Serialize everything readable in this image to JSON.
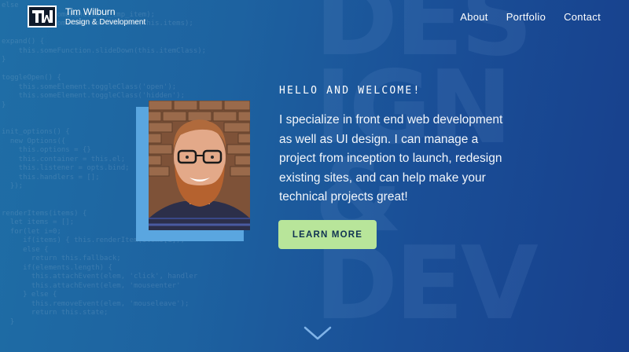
{
  "header": {
    "logo_text": "TW",
    "brand_name": "Tim Wilburn",
    "brand_sub": "Design & Development",
    "nav": [
      {
        "label": "About"
      },
      {
        "label": "Portfolio"
      },
      {
        "label": "Contact"
      }
    ]
  },
  "hero": {
    "eyebrow": "HELLO AND WELCOME!",
    "intro": "I specialize in front end web development as well as UI design. I can manage a project from inception to launch, redesign existing sites, and can help make your technical projects great!",
    "cta_label": "LEARN MORE"
  },
  "background": {
    "big_letters": [
      "DES",
      "IGN",
      "&",
      "DEV"
    ],
    "code_lines": [
      "else",
      "       this.someFunction(_tmp_item);",
      "       this.someFunction.addItem(this.items);",
      "",
      "expand() {",
      "    this.someFunction.slideDown(this.itemClass);",
      "}",
      "",
      "toggleOpen() {",
      "    this.someElement.toggleClass('open');",
      "    this.someElement.toggleClass('hidden');",
      "}",
      "",
      "",
      "init_options() {",
      "  new Options({",
      "    this.options = {}",
      "    this.container = this.el;",
      "    this.listener = opts.bind;",
      "    this.handlers = [];",
      "  });",
      "",
      "",
      "renderItems(items) {",
      "  let items = [];",
      "  for(let i=0;",
      "     if(items) { this.renderItem(items[i]);",
      "     else {",
      "       return this.fallback;",
      "     if(elements.length) {",
      "       this.attachEvent(elem, 'click', handler",
      "       this.attachEvent(elem, 'mouseenter'",
      "     } else {",
      "       this.removeEvent(elem, 'mouseleave');",
      "       return this.state;",
      "  }"
    ]
  },
  "colors": {
    "accent": "#b8e59a",
    "photo_frame": "#5aa6e0",
    "background_start": "#1f6ea6",
    "background_end": "#173f8c"
  },
  "icons": {
    "scroll": "chevron-down-icon"
  }
}
